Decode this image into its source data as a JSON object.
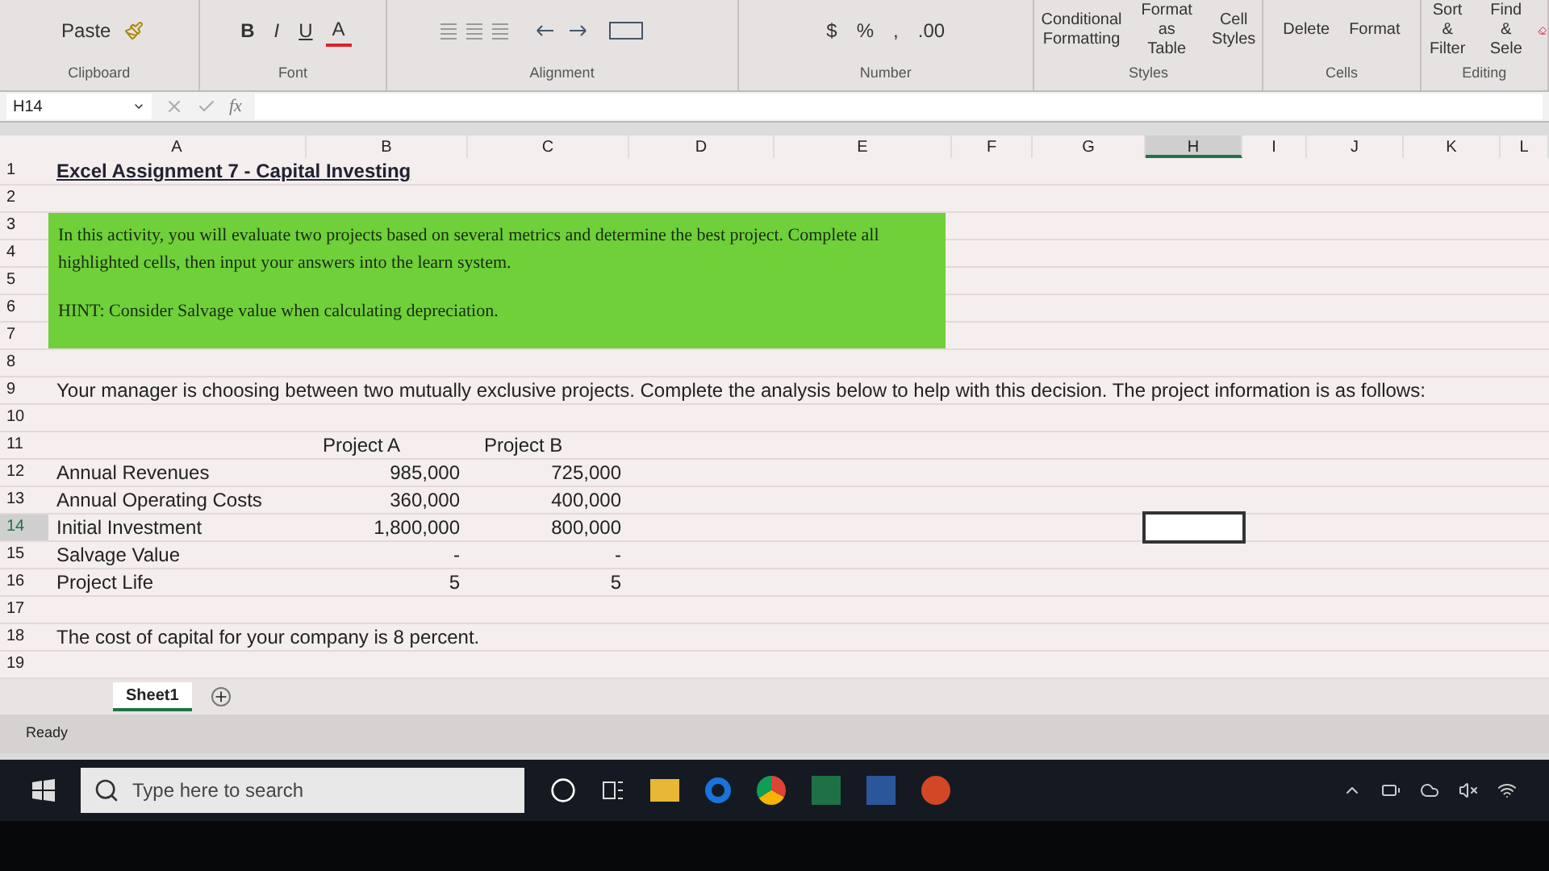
{
  "ribbon": {
    "groups": [
      {
        "label": "Clipboard",
        "buttons": [
          "Paste"
        ]
      },
      {
        "label": "Font",
        "buttons": [
          "B",
          "I",
          "U",
          "A"
        ]
      },
      {
        "label": "Alignment"
      },
      {
        "label": "Number",
        "buttons": [
          "$",
          "%",
          ",",
          ".00"
        ]
      },
      {
        "label": "Styles",
        "buttons": [
          "Conditional Formatting",
          "Format as Table",
          "Cell Styles"
        ]
      },
      {
        "label": "Cells",
        "buttons": [
          "Delete",
          "Format"
        ]
      },
      {
        "label": "Editing",
        "buttons": [
          "Sort & Filter",
          "Find & Sele"
        ]
      }
    ]
  },
  "formula_bar": {
    "name_box": "H14",
    "fx": "fx"
  },
  "columns": [
    {
      "label": "A",
      "selected": false
    },
    {
      "label": "B",
      "selected": false
    },
    {
      "label": "C",
      "selected": false
    },
    {
      "label": "D",
      "selected": false
    },
    {
      "label": "E",
      "selected": false
    },
    {
      "label": "F",
      "selected": false
    },
    {
      "label": "G",
      "selected": false
    },
    {
      "label": "H",
      "selected": true
    },
    {
      "label": "I",
      "selected": false
    },
    {
      "label": "J",
      "selected": false
    },
    {
      "label": "K",
      "selected": false
    },
    {
      "label": "L",
      "selected": false
    }
  ],
  "rows": [
    {
      "num": "1",
      "selected": false,
      "kind": "title",
      "a": "Excel Assignment 7 - Capital Investing"
    },
    {
      "num": "2",
      "selected": false,
      "kind": "blank"
    },
    {
      "num": "3",
      "selected": false,
      "kind": "blank"
    },
    {
      "num": "4",
      "selected": false,
      "kind": "blank"
    },
    {
      "num": "5",
      "selected": false,
      "kind": "blank"
    },
    {
      "num": "6",
      "selected": false,
      "kind": "blank"
    },
    {
      "num": "7",
      "selected": false,
      "kind": "blank"
    },
    {
      "num": "8",
      "selected": false,
      "kind": "blank"
    },
    {
      "num": "9",
      "selected": false,
      "kind": "text",
      "a": "Your manager is choosing between two mutually exclusive projects. Complete the analysis below to help with this decision. The project information is as follows:"
    },
    {
      "num": "10",
      "selected": false,
      "kind": "blank"
    },
    {
      "num": "11",
      "selected": false,
      "kind": "headers",
      "b": "Project A",
      "c": "Project B"
    },
    {
      "num": "12",
      "selected": false,
      "kind": "values",
      "a": "Annual Revenues",
      "b": "985,000",
      "c": "725,000"
    },
    {
      "num": "13",
      "selected": false,
      "kind": "values",
      "a": "Annual Operating Costs",
      "b": "360,000",
      "c": "400,000"
    },
    {
      "num": "14",
      "selected": true,
      "kind": "values",
      "a": "Initial Investment",
      "b": "1,800,000",
      "c": "800,000"
    },
    {
      "num": "15",
      "selected": false,
      "kind": "values",
      "a": "Salvage Value",
      "b": "-",
      "c": "-"
    },
    {
      "num": "16",
      "selected": false,
      "kind": "values",
      "a": "Project Life",
      "b": "5",
      "c": "5"
    },
    {
      "num": "17",
      "selected": false,
      "kind": "blank"
    },
    {
      "num": "18",
      "selected": false,
      "kind": "text",
      "a": "The cost of capital for your company is 8 percent."
    },
    {
      "num": "19",
      "selected": false,
      "kind": "blank"
    }
  ],
  "note_box": {
    "paragraphs": [
      "In this activity, you will evaluate two projects based on several metrics and determine the best project. Complete all highlighted cells, then input your answers into the learn system.",
      "HINT: Consider Salvage value when calculating depreciation."
    ]
  },
  "sheet_tabs": [
    {
      "label": "Sheet1",
      "selected": true
    }
  ],
  "status_bar": {
    "text": "Ready"
  },
  "taskbar": {
    "search_placeholder": "Type here to search"
  }
}
